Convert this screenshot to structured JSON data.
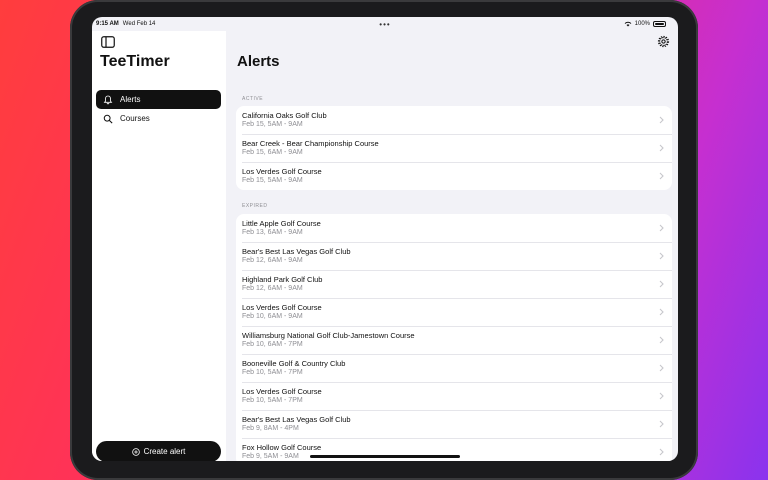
{
  "status_bar": {
    "time": "9:15 AM",
    "date": "Wed Feb 14",
    "battery": "100%"
  },
  "sidebar": {
    "app_title": "TeeTimer",
    "items": [
      {
        "label": "Alerts",
        "icon": "bell-icon",
        "active": true
      },
      {
        "label": "Courses",
        "icon": "search-icon",
        "active": false
      }
    ],
    "create_button": "Create alert"
  },
  "main": {
    "title": "Alerts",
    "active_label": "ACTIVE",
    "expired_label": "EXPIRED",
    "active": [
      {
        "name": "California Oaks Golf Club",
        "time": "Feb 15, 5AM - 9AM"
      },
      {
        "name": "Bear Creek - Bear Championship Course",
        "time": "Feb 15, 6AM - 9AM"
      },
      {
        "name": "Los Verdes Golf Course",
        "time": "Feb 15, 5AM - 9AM"
      }
    ],
    "expired": [
      {
        "name": "Little Apple Golf Course",
        "time": "Feb 13, 6AM - 9AM"
      },
      {
        "name": "Bear's Best Las Vegas Golf Club",
        "time": "Feb 12, 6AM - 9AM"
      },
      {
        "name": "Highland Park Golf Club",
        "time": "Feb 12, 6AM - 9AM"
      },
      {
        "name": "Los Verdes Golf Course",
        "time": "Feb 10, 6AM - 9AM"
      },
      {
        "name": "Williamsburg National Golf Club-Jamestown Course",
        "time": "Feb 10, 6AM - 7PM"
      },
      {
        "name": "Booneville Golf & Country Club",
        "time": "Feb 10, 5AM - 7PM"
      },
      {
        "name": "Los Verdes Golf Course",
        "time": "Feb 10, 5AM - 7PM"
      },
      {
        "name": "Bear's Best Las Vegas Golf Club",
        "time": "Feb 9, 8AM - 4PM"
      },
      {
        "name": "Fox Hollow Golf Course",
        "time": "Feb 9, 5AM - 9AM"
      }
    ]
  },
  "colors": {
    "accent": "#111111",
    "background": "#f2f2f7",
    "secondary_text": "#8e8e93"
  }
}
